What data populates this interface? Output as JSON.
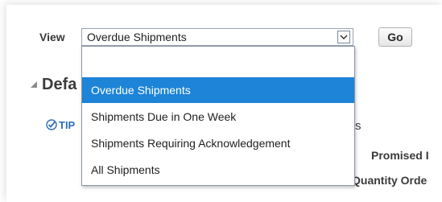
{
  "view": {
    "label": "View",
    "selected_value": "Overdue Shipments",
    "go_label": "Go"
  },
  "section": {
    "title_fragment": "Defa",
    "tip_fragment": "TIP"
  },
  "table_fragments": {
    "header_tail_s": "s",
    "promised_fragment": "Promised I",
    "quantity_fragment": "Quantity Orde"
  },
  "dropdown": {
    "options": [
      {
        "label": ""
      },
      {
        "label": "Overdue Shipments"
      },
      {
        "label": "Shipments Due in One Week"
      },
      {
        "label": "Shipments Requiring Acknowledgement"
      },
      {
        "label": "All Shipments"
      }
    ],
    "highlighted_index": 1
  },
  "colors": {
    "highlight": "#1d84d8",
    "tip_blue": "#2f6fb5"
  }
}
